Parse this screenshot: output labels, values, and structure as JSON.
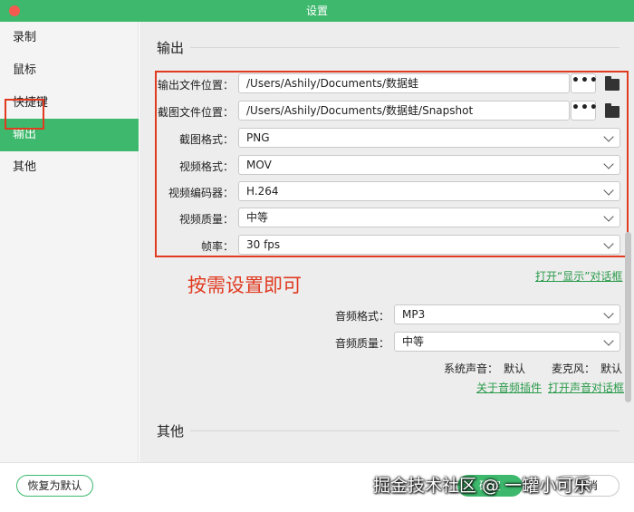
{
  "window": {
    "title": "设置"
  },
  "sidebar": {
    "items": [
      {
        "label": "录制"
      },
      {
        "label": "鼠标"
      },
      {
        "label": "快捷键"
      },
      {
        "label": "输出",
        "active": true
      },
      {
        "label": "其他"
      }
    ]
  },
  "output": {
    "section_title": "输出",
    "output_path": {
      "label": "输出文件位置：",
      "value": "/Users/Ashily/Documents/数据蛙",
      "browse": "•••"
    },
    "snapshot_path": {
      "label": "截图文件位置：",
      "value": "/Users/Ashily/Documents/数据蛙/Snapshot",
      "browse": "•••"
    },
    "snapshot_format": {
      "label": "截图格式：",
      "value": "PNG"
    },
    "video_format": {
      "label": "视频格式：",
      "value": "MOV"
    },
    "video_codec": {
      "label": "视频编码器：",
      "value": "H.264"
    },
    "video_quality": {
      "label": "视频质量：",
      "value": "中等"
    },
    "frame_rate": {
      "label": "帧率：",
      "value": "30 fps"
    },
    "annotation": "按需设置即可",
    "open_display_link": "打开“显示”对话框",
    "audio_format": {
      "label": "音频格式：",
      "value": "MP3"
    },
    "audio_quality": {
      "label": "音频质量：",
      "value": "中等"
    },
    "system_sound": {
      "label": "系统声音：",
      "value": "默认"
    },
    "microphone": {
      "label": "麦克风：",
      "value": "默认"
    },
    "about_audio_plugin_link": "关于音频插件",
    "open_sound_link": "打开声音对话框"
  },
  "other": {
    "section_title": "其他"
  },
  "footer": {
    "restore_label": "恢复为默认",
    "ok_label": "确定",
    "cancel_label": "取消",
    "watermark": "掘金技术社区 @ 一罐小可乐"
  },
  "colors": {
    "accent": "#3db86c",
    "annotation": "#e03a20"
  }
}
